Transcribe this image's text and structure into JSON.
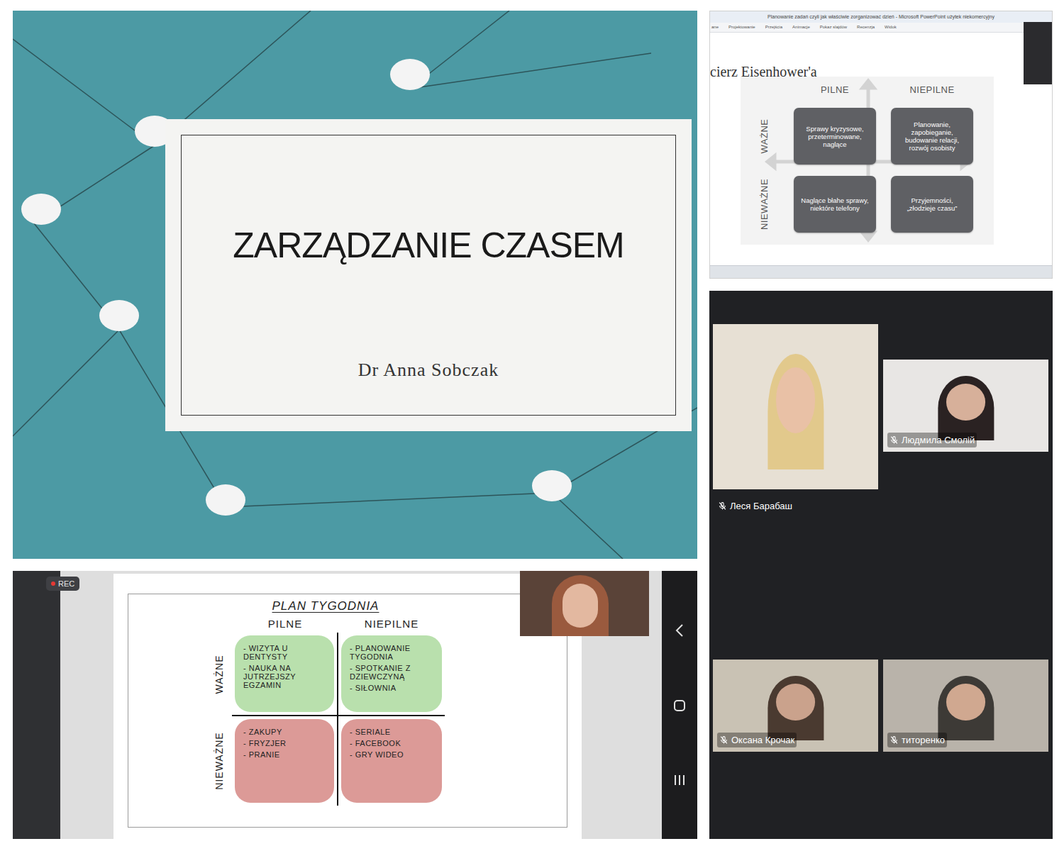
{
  "title_slide": {
    "title": "ZARZĄDZANIE CZASEM",
    "author": "Dr Anna Sobczak"
  },
  "powerpoint": {
    "window_title": "Planowanie zadań czyli jak właściwie zorganizować dzień - Microsoft PowerPoint użytek niekomercyjny",
    "ribbon_tabs": [
      "ane",
      "Projektowanie",
      "Przejścia",
      "Animacje",
      "Pokaz slajdów",
      "Recenzja",
      "Widok"
    ],
    "slide_title": "cierz Eisenhower'a",
    "columns": [
      "PILNE",
      "NIEPILNE"
    ],
    "rows": [
      "WAŻNE",
      "NIEWAŻNE"
    ],
    "cells": [
      [
        "Sprawy kryzysowe, przeterminowane, naglące",
        "Planowanie, zapobieganie, budowanie relacji, rozwój osobisty"
      ],
      [
        "Naglące błahe sprawy, niektóre telefony",
        "Przyjemności, „złodzieje czasu”"
      ]
    ]
  },
  "whiteboard": {
    "rec_label": "REC",
    "title": "PLAN TYGODNIA",
    "columns": [
      "PILNE",
      "NIEPILNE"
    ],
    "rows": [
      {
        "label": "WAŻNE",
        "color": "#b9e0ad",
        "cells": [
          [
            "- WIZYTA U DENTYSTY",
            "- NAUKA NA JUTRZEJSZY EGZAMIN"
          ],
          [
            "- PLANOWANIE TYGODNIA",
            "- SPOTKANIE Z DZIEWCZYNĄ",
            "- SIŁOWNIA"
          ]
        ]
      },
      {
        "label": "NIEWAŻNE",
        "color": "#dc9a97",
        "cells": [
          [
            "- ZAKUPY",
            "- FRYZJER",
            "- PRANIE"
          ],
          [
            "- SERIALE",
            "- FACEBOOK",
            "- GRY WIDEO"
          ]
        ]
      }
    ]
  },
  "participants": [
    {
      "name": "Леся Барабаш",
      "muted": true
    },
    {
      "name": "Людмила Смолій",
      "muted": true
    },
    {
      "name": "Оксана Крочак",
      "muted": true
    },
    {
      "name": "титоренко",
      "muted": true
    }
  ]
}
